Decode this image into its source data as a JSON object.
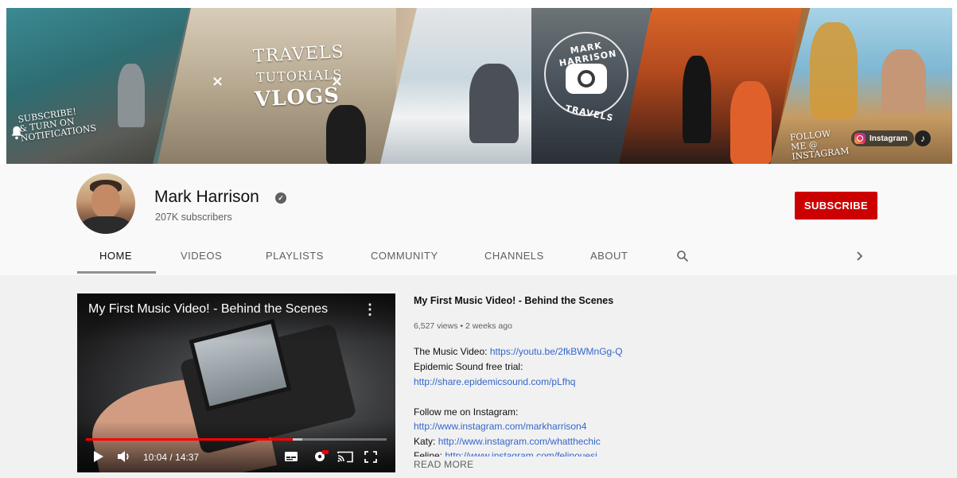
{
  "banner": {
    "tagline": [
      "TRAVELS",
      "TUTORIALS",
      "VLOGS"
    ],
    "separator": "×",
    "logo_top": "MARK HARRISON",
    "logo_bottom": "TRAVELS",
    "subscribe_reminder": "SUBSCRIBE! & TURN ON NOTIFICATIONS",
    "follow_text": "FOLLOW ME @ INSTAGRAM",
    "instagram_label": "Instagram",
    "tiktok_glyph": "♪"
  },
  "channel": {
    "name": "Mark Harrison",
    "verified_glyph": "✓",
    "subscribers": "207K subscribers",
    "subscribe_label": "SUBSCRIBE"
  },
  "tabs": [
    {
      "label": "HOME",
      "active": true
    },
    {
      "label": "VIDEOS"
    },
    {
      "label": "PLAYLISTS"
    },
    {
      "label": "COMMUNITY"
    },
    {
      "label": "CHANNELS"
    },
    {
      "label": "ABOUT"
    }
  ],
  "featured": {
    "player_title": "My First Music Video! - Behind the Scenes",
    "time_display": "10:04 / 14:37",
    "progress_percent": 68.7,
    "buffer_percent": 72,
    "title": "My First Music Video! - Behind the Scenes",
    "meta": "6,527 views • 2 weeks ago",
    "description": [
      {
        "text": "The Music Video: ",
        "link": "https://youtu.be/2fkBWMnGg-Q"
      },
      {
        "text": "Epidemic Sound free trial:",
        "link": ""
      },
      {
        "text": "",
        "link": "http://share.epidemicsound.com/pLfhq"
      },
      {
        "text": "",
        "link": ""
      },
      {
        "text": "Follow me on Instagram:",
        "link": ""
      },
      {
        "text": "",
        "link": "http://www.instagram.com/markharrison4"
      },
      {
        "text": "Katy: ",
        "link": "http://www.instagram.com/whatthechic"
      },
      {
        "text": "Feline: ",
        "link": "http://www.instagram.com/felinouesi"
      }
    ],
    "read_more": "READ MORE"
  },
  "colors": {
    "subscribe_red": "#cc0000",
    "link_blue": "#3366cc",
    "progress_red": "#ff0000"
  }
}
